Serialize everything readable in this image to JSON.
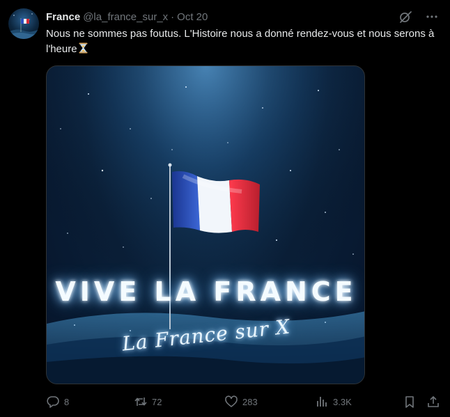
{
  "author": {
    "name": "France",
    "handle": "@la_france_sur_x",
    "separator": "·",
    "date": "Oct 20",
    "avatar_icon": "france-flag-avatar-icon"
  },
  "tweet": {
    "text": "Nous ne sommes pas foutus. L'Histoire nous a donné rendez-vous et nous serons à l'heure",
    "emoji_icon": "hourglass-icon"
  },
  "media": {
    "headline": "VIVE LA FRANCE",
    "signature": "La France sur X",
    "flag_colors": [
      "#1f3fa8",
      "#ffffff",
      "#e0263a"
    ],
    "glow_color": "#9fd4ff"
  },
  "actions": {
    "replies": "8",
    "reposts": "72",
    "likes": "283",
    "views": "3.3K",
    "icons": [
      "reply-icon",
      "repost-icon",
      "like-icon",
      "views-icon",
      "bookmark-icon",
      "share-icon"
    ]
  },
  "top_icons": [
    "grok-icon",
    "more-icon"
  ]
}
